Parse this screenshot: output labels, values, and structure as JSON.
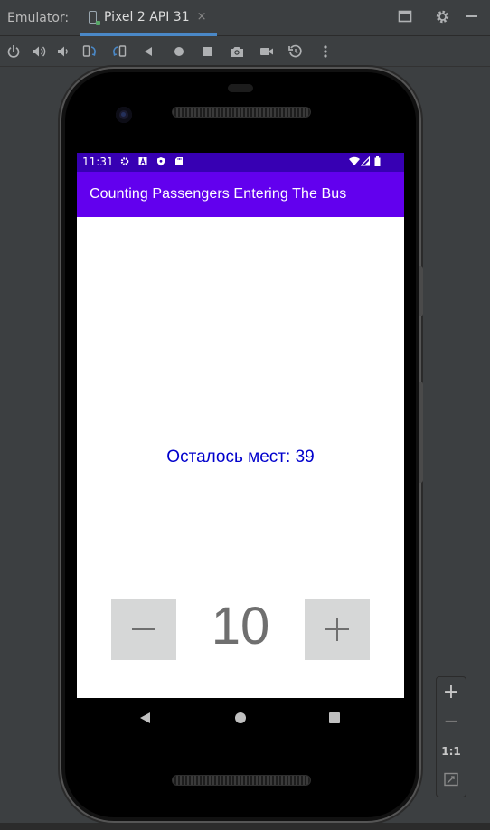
{
  "ide": {
    "panel_label": "Emulator:",
    "tab_label": "Pixel 2 API 31",
    "tab_close": "×",
    "window_icons": [
      "window-layout-icon",
      "gear-icon",
      "minimize-icon"
    ],
    "toolbar_icons": [
      "power-icon",
      "volume-up-icon",
      "volume-down-icon",
      "rotate-left-icon",
      "rotate-right-icon",
      "back-icon",
      "home-icon",
      "overview-icon",
      "camera-icon",
      "video-record-icon",
      "snapshot-icon",
      "more-icon"
    ]
  },
  "device": {
    "status": {
      "time": "11:31",
      "icons": [
        "settings-icon",
        "font-icon",
        "shield-icon",
        "sd-card-icon",
        "wifi-icon",
        "signal-icon",
        "battery-icon"
      ]
    },
    "app": {
      "title": "Counting Passengers Entering The Bus",
      "seats_left": "Осталось мест: 39",
      "decrement_label": "−",
      "count": "10",
      "increment_label": "+"
    },
    "nav": [
      "back-icon",
      "home-icon",
      "recents-icon"
    ]
  },
  "zoom_panel": {
    "zoom_in": "+",
    "zoom_out": "−",
    "actual_size": "1:1",
    "fit": "fit-screen-icon"
  },
  "colors": {
    "status_bar": "#3700b3",
    "app_bar": "#6200ee",
    "seats_text": "#0000cc",
    "counter_text": "#6f6f6f",
    "stepper_bg": "#d6d7d7",
    "ide_bg": "#3c3f41"
  }
}
